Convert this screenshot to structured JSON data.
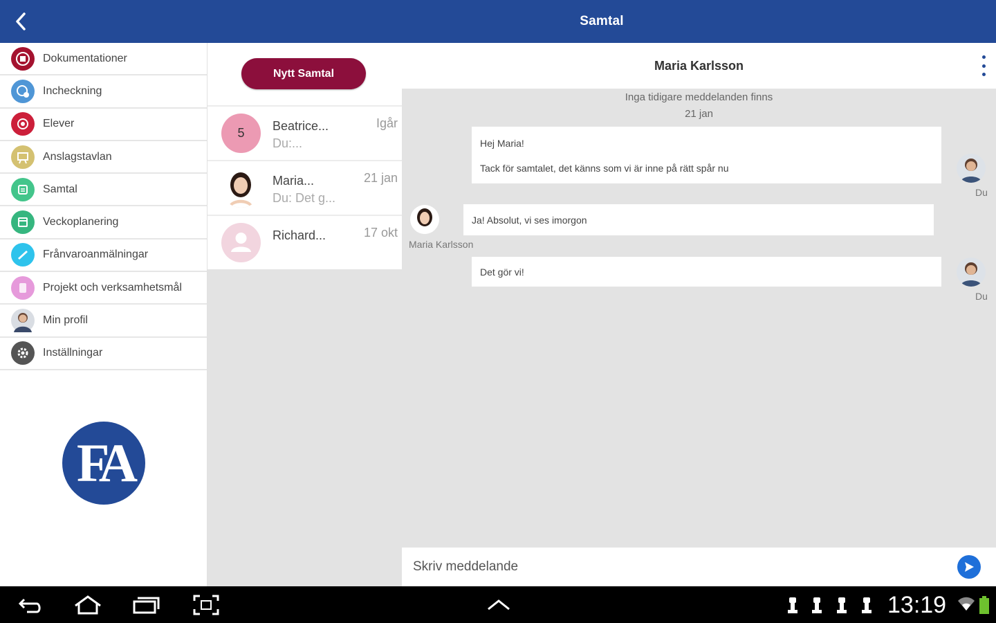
{
  "app": {
    "title": "Samtal"
  },
  "colors": {
    "primary": "#234a97",
    "accent": "#8c0f3c",
    "send": "#1e6fd9"
  },
  "sidebar": {
    "items": [
      {
        "label": "Dokumentationer",
        "icon": "documents-icon",
        "color": "#a4122f"
      },
      {
        "label": "Incheckning",
        "icon": "checkin-icon",
        "color": "#4f96d6"
      },
      {
        "label": "Elever",
        "icon": "students-icon",
        "color": "#cc1f3a"
      },
      {
        "label": "Anslagstavlan",
        "icon": "bulletin-board-icon",
        "color": "#d4c171"
      },
      {
        "label": "Samtal",
        "icon": "chat-icon",
        "color": "#43c58b"
      },
      {
        "label": "Veckoplanering",
        "icon": "week-planning-icon",
        "color": "#36b67f"
      },
      {
        "label": "Frånvaroanmälningar",
        "icon": "absence-icon",
        "color": "#2ec3ec"
      },
      {
        "label": "Projekt och verksamhetsmål",
        "icon": "project-icon",
        "color": "#e69adb"
      },
      {
        "label": "Min profil",
        "icon": "profile-icon",
        "color": "#888888"
      },
      {
        "label": "Inställningar",
        "icon": "settings-icon",
        "color": "#555555"
      }
    ],
    "logo_text": "FA"
  },
  "conversations": {
    "new_button": "Nytt Samtal",
    "items": [
      {
        "name": "Beatrice...",
        "preview": "Du:...",
        "date": "Igår",
        "badge": "5"
      },
      {
        "name": "Maria...",
        "preview": "Du: Det g...",
        "date": "21 jan"
      },
      {
        "name": "Richard...",
        "preview": "",
        "date": "17 okt"
      }
    ]
  },
  "chat": {
    "contact_name": "Maria Karlsson",
    "no_earlier": "Inga tidigare meddelanden finns",
    "date_sep": "21 jan",
    "messages": [
      {
        "from": "Du",
        "lines": [
          "Hej Maria!",
          "Tack för samtalet, det känns som vi är inne på rätt spår nu"
        ]
      },
      {
        "from": "Maria Karlsson",
        "lines": [
          "Ja! Absolut, vi ses imorgon"
        ]
      },
      {
        "from": "Du",
        "lines": [
          "Det gör vi!"
        ]
      }
    ],
    "composer_placeholder": "Skriv meddelande"
  },
  "status": {
    "time": "13:19"
  }
}
